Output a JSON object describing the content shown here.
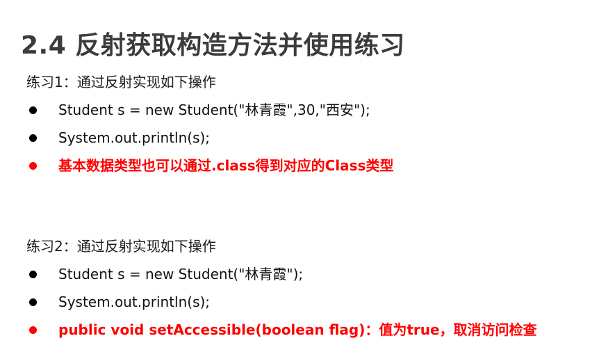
{
  "title": "2.4 反射获取构造方法并使用练习",
  "exercise1": {
    "heading": "练习1：通过反射实现如下操作",
    "bullets": [
      "Student s = new Student(\"林青霞\",30,\"西安\");",
      "System.out.println(s);",
      "基本数据类型也可以通过.class得到对应的Class类型"
    ]
  },
  "exercise2": {
    "heading": "练习2：通过反射实现如下操作",
    "bullets": [
      "Student s = new Student(\"林青霞\");",
      "System.out.println(s);",
      "public void setAccessible(boolean flag)：值为true，取消访问检查"
    ]
  },
  "colors": {
    "title": "#3b3b3b",
    "highlight": "#ff0000",
    "text": "#1b1b1b"
  }
}
